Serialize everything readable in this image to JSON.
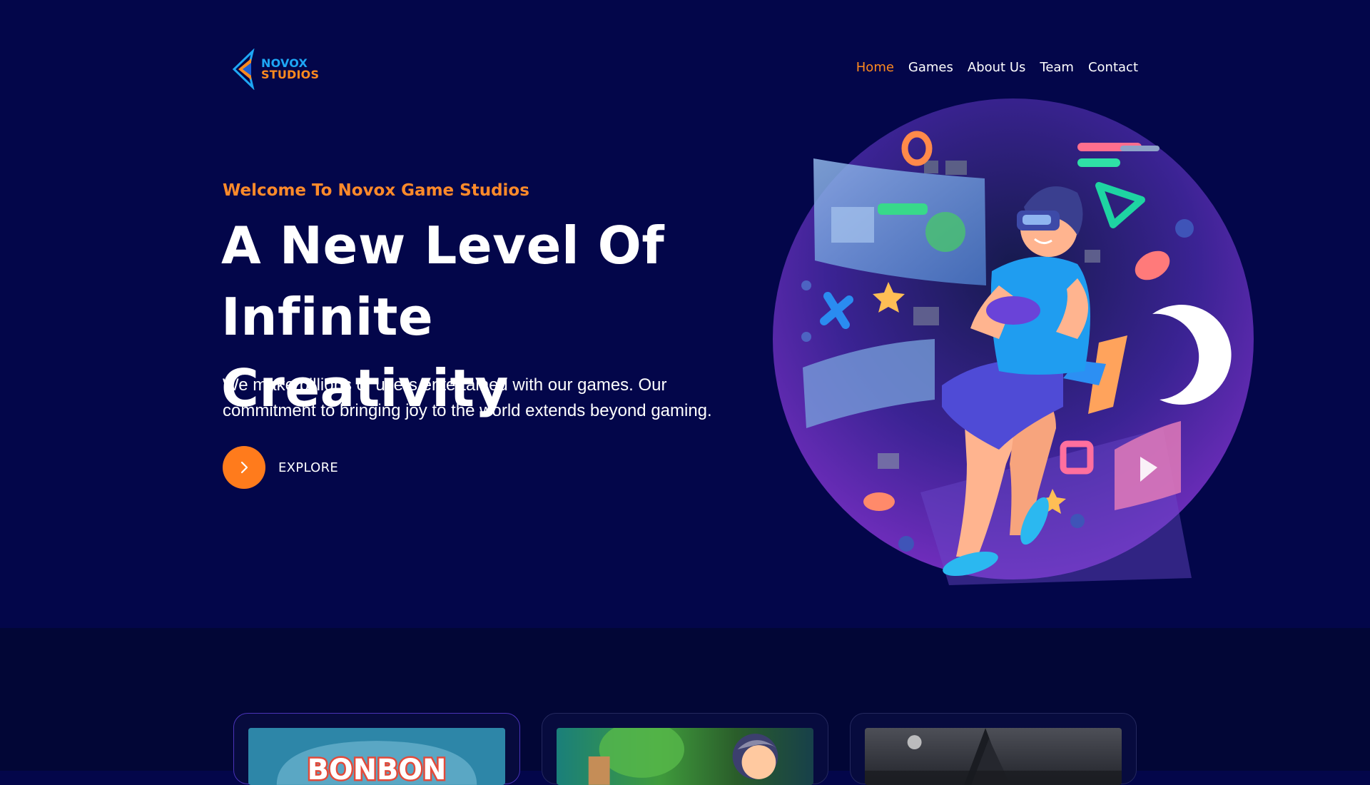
{
  "brand": {
    "name_line1": "NOVOX",
    "name_line2": "STUDIOS",
    "colors": {
      "blue": "#1ea7f5",
      "orange": "#ff8a1e"
    }
  },
  "nav": {
    "items": [
      {
        "label": "Home",
        "active": true
      },
      {
        "label": "Games",
        "active": false
      },
      {
        "label": "About Us",
        "active": false
      },
      {
        "label": "Team",
        "active": false
      },
      {
        "label": "Contact",
        "active": false
      }
    ]
  },
  "hero": {
    "eyebrow": "Welcome To Novox Game Studios",
    "headline_line1": "A New Level Of",
    "headline_line2": "Infinite Creativity",
    "subtext": "We make billions of users entertained with our games. Our commitment to bringing joy to the world extends beyond gaming.",
    "cta_label": "EXPLORE",
    "cta_icon": "chevron-right-icon",
    "illustration": "vr-gamer-illustration"
  },
  "games": {
    "cards": [
      {
        "thumb_text": "BONBON",
        "thumb_theme": "candy"
      },
      {
        "thumb_theme": "cartoon-forest"
      },
      {
        "thumb_theme": "dark-forest"
      }
    ]
  },
  "colors": {
    "background": "#03064a",
    "section_bg": "#020636",
    "accent": "#ff7b1c"
  }
}
